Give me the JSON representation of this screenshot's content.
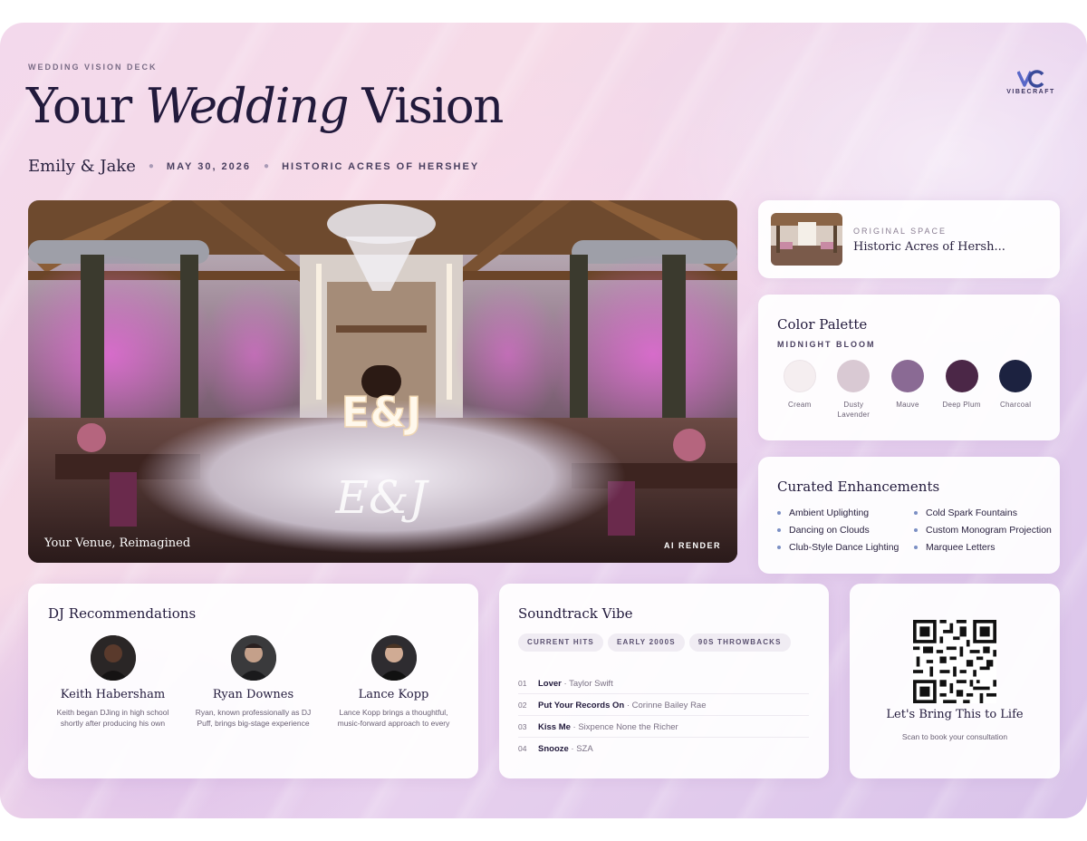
{
  "header": {
    "kicker": "WEDDING VISION DECK",
    "title_part1": "Your ",
    "title_emphasis": "Wedding",
    "title_part2": " Vision",
    "couple": "Emily & Jake",
    "date": "MAY 30, 2026",
    "venue": "HISTORIC ACRES OF HERSHEY",
    "brand": "VIBECRAFT"
  },
  "hero": {
    "monogram": "E&J",
    "script_monogram": "E&J",
    "caption": "Your Venue, Reimagined",
    "badge": "AI RENDER"
  },
  "original_space": {
    "kicker": "ORIGINAL SPACE",
    "name": "Historic Acres of Hersh..."
  },
  "palette": {
    "title": "Color Palette",
    "name": "MIDNIGHT BLOOM",
    "swatches": [
      {
        "label": "Cream",
        "color": "#f5eef0"
      },
      {
        "label": "Dusty Lavender",
        "color": "#d9c9d3"
      },
      {
        "label": "Mauve",
        "color": "#8a6a94"
      },
      {
        "label": "Deep Plum",
        "color": "#4b2747"
      },
      {
        "label": "Charcoal",
        "color": "#1c2240"
      }
    ]
  },
  "enhancements": {
    "title": "Curated Enhancements",
    "items": [
      "Ambient Uplighting",
      "Cold Spark Fountains",
      "Dancing on Clouds",
      "Custom Monogram Projection",
      "Club-Style Dance Lighting",
      "Marquee Letters"
    ]
  },
  "dj": {
    "title": "DJ Recommendations",
    "djs": [
      {
        "name": "Keith Habersham",
        "bio": "Keith began DJing in high school shortly after producing his own"
      },
      {
        "name": "Ryan Downes",
        "bio": "Ryan, known professionally as DJ Puff, brings big-stage experience"
      },
      {
        "name": "Lance Kopp",
        "bio": "Lance Kopp brings a thoughtful, music-forward approach to every"
      }
    ]
  },
  "soundtrack": {
    "title": "Soundtrack Vibe",
    "chips": [
      "CURRENT HITS",
      "EARLY 2000S",
      "90S THROWBACKS"
    ],
    "tracks": [
      {
        "num": "01",
        "song": "Lover",
        "artist": " · Taylor Swift"
      },
      {
        "num": "02",
        "song": "Put Your Records On",
        "artist": " · Corinne Bailey Rae"
      },
      {
        "num": "03",
        "song": "Kiss Me",
        "artist": " · Sixpence None the Richer"
      },
      {
        "num": "04",
        "song": "Snooze",
        "artist": " · SZA"
      }
    ]
  },
  "cta": {
    "title": "Let's Bring This to Life",
    "subtitle": "Scan to book your consultation"
  }
}
